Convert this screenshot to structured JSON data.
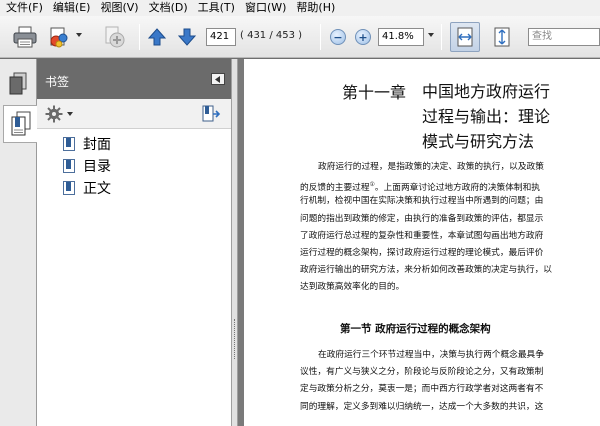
{
  "menu": {
    "items": [
      "文件(F)",
      "编辑(E)",
      "视图(V)",
      "文档(D)",
      "工具(T)",
      "窗口(W)",
      "帮助(H)"
    ]
  },
  "toolbar": {
    "current_page": "421",
    "page_total": "( 431 / 453 )",
    "zoom": "41.8%",
    "search_placeholder": "查找"
  },
  "bookmarks": {
    "title": "书签",
    "items": [
      {
        "label": "封面"
      },
      {
        "label": "目录"
      },
      {
        "label": "正文"
      }
    ]
  },
  "document": {
    "chapter_number": "第十一章",
    "chapter_title_lines": [
      "中国地方政府运行",
      "过程与输出：理论",
      "模式与研究方法"
    ],
    "intro_lines": [
      "政府运行的过程，是指政策的决定、政策的执行，以及政策",
      "的反馈的主要过程",
      "行机制，检视中国在实际决策和执行过程当中所遇到的问题；由",
      "问题的指出到政策的修定，由执行的准备到政策的评估，都显示",
      "了政府运行总过程的复杂性和重要性，本章试图勾画出地方政府",
      "运行过程的概念架构，探讨政府运行过程的理论模式，最后评价",
      "政府运行输出的研究方法，来分析如何改善政策的决定与执行，以",
      "达到政策高效率化的目的。"
    ],
    "intro_footnote": "①",
    "intro_line2_rest": "。上面两章讨论过地方政府的决策体制和执",
    "section_title": "第一节  政府运行过程的概念架构",
    "section_lines": [
      "在政府运行三个环节过程当中，决策与执行两个概念最具争",
      "议性，有广义与狭义之分，阶段论与反阶段论之分，又有政策制",
      "定与政策分析之分，莫衷一是；而中西方行政学者对这两者有不",
      "同的理解，定义多到难以归纳统一，达成一个大多数的共识，这"
    ]
  }
}
